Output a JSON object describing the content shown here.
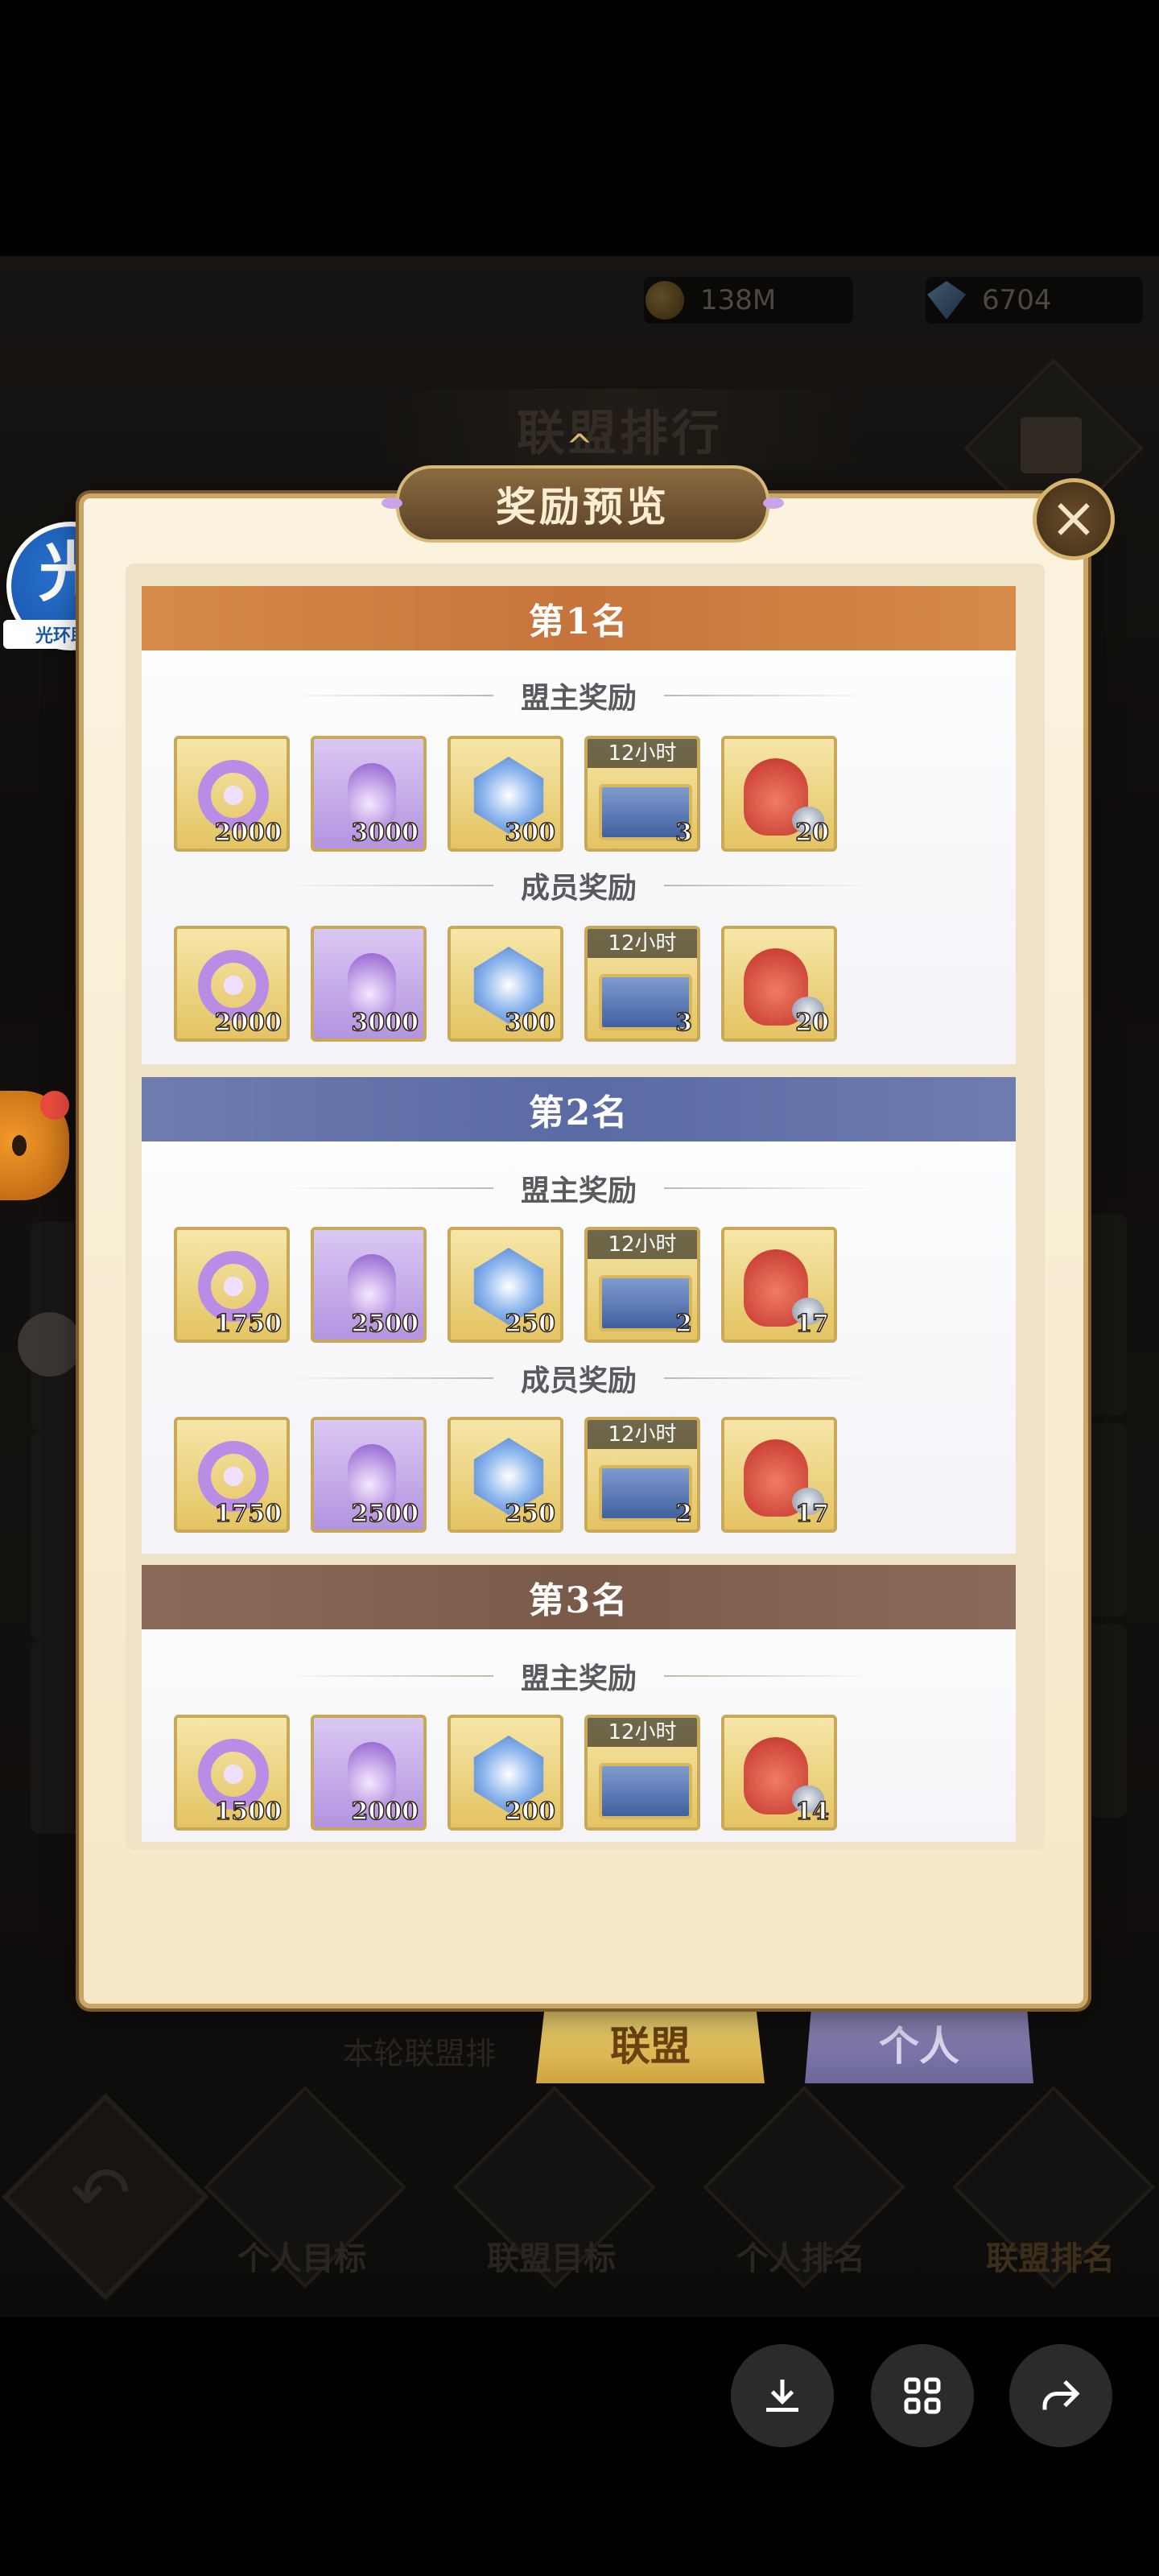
{
  "resources": {
    "gold": "138M",
    "diamonds": "6704"
  },
  "bg_title": "联盟排行",
  "panel_title": "奖励预览",
  "floating_app": {
    "glyph": "光",
    "label": "光环助手"
  },
  "sections": [
    {
      "rank": "第1名",
      "groups": [
        {
          "label": "盟主奖励",
          "items": [
            {
              "icon": "ring-icon",
              "qty": "2000"
            },
            {
              "icon": "potion-icon",
              "qty": "3000"
            },
            {
              "icon": "crystal-icon",
              "qty": "300"
            },
            {
              "icon": "chest-icon",
              "qty": "3",
              "tag": "12小时"
            },
            {
              "icon": "bag-icon",
              "qty": "20"
            }
          ]
        },
        {
          "label": "成员奖励",
          "items": [
            {
              "icon": "ring-icon",
              "qty": "2000"
            },
            {
              "icon": "potion-icon",
              "qty": "3000"
            },
            {
              "icon": "crystal-icon",
              "qty": "300"
            },
            {
              "icon": "chest-icon",
              "qty": "3",
              "tag": "12小时"
            },
            {
              "icon": "bag-icon",
              "qty": "20"
            }
          ]
        }
      ]
    },
    {
      "rank": "第2名",
      "groups": [
        {
          "label": "盟主奖励",
          "items": [
            {
              "icon": "ring-icon",
              "qty": "1750"
            },
            {
              "icon": "potion-icon",
              "qty": "2500"
            },
            {
              "icon": "crystal-icon",
              "qty": "250"
            },
            {
              "icon": "chest-icon",
              "qty": "2",
              "tag": "12小时"
            },
            {
              "icon": "bag-icon",
              "qty": "17"
            }
          ]
        },
        {
          "label": "成员奖励",
          "items": [
            {
              "icon": "ring-icon",
              "qty": "1750"
            },
            {
              "icon": "potion-icon",
              "qty": "2500"
            },
            {
              "icon": "crystal-icon",
              "qty": "250"
            },
            {
              "icon": "chest-icon",
              "qty": "2",
              "tag": "12小时"
            },
            {
              "icon": "bag-icon",
              "qty": "17"
            }
          ]
        }
      ]
    },
    {
      "rank": "第3名",
      "groups": [
        {
          "label": "盟主奖励",
          "items": [
            {
              "icon": "ring-icon",
              "qty": "1500"
            },
            {
              "icon": "potion-icon",
              "qty": "2000"
            },
            {
              "icon": "crystal-icon",
              "qty": "200"
            },
            {
              "icon": "chest-icon",
              "qty": "",
              "tag": "12小时"
            },
            {
              "icon": "bag-icon",
              "qty": "14"
            }
          ]
        }
      ]
    }
  ],
  "bottom_text": "本轮联盟排",
  "tabs": {
    "alliance": "联盟",
    "personal": "个人"
  },
  "nav": [
    "个人目标",
    "联盟目标",
    "个人排名",
    "联盟排名"
  ],
  "system_buttons": [
    "download-icon",
    "grid-icon",
    "share-icon"
  ]
}
